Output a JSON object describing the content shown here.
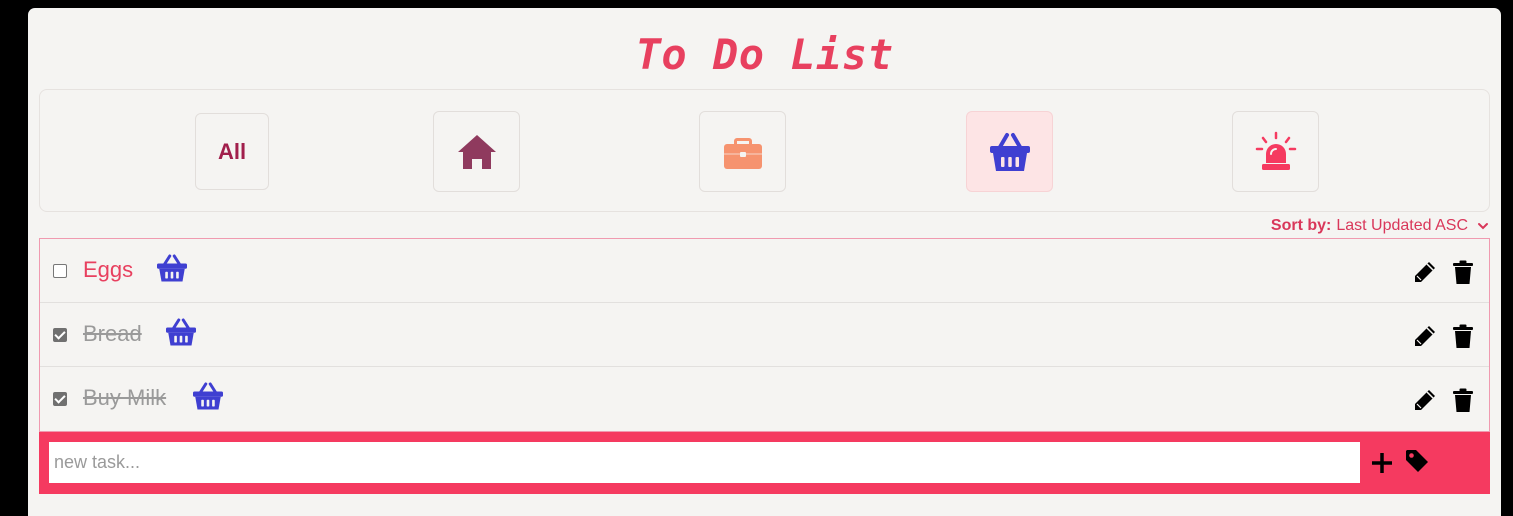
{
  "app": {
    "title": "To Do List"
  },
  "filters": [
    {
      "label": "All",
      "icon": "",
      "active": false
    },
    {
      "label": "",
      "icon": "home-icon",
      "active": false
    },
    {
      "label": "",
      "icon": "briefcase-icon",
      "active": false
    },
    {
      "label": "",
      "icon": "basket-icon",
      "active": true
    },
    {
      "label": "",
      "icon": "alarm-siren-icon",
      "active": false
    }
  ],
  "sort": {
    "label": "Sort by:",
    "value": "Last Updated ASC"
  },
  "tasks": [
    {
      "text": "Eggs",
      "done": false,
      "category_icon": "basket-icon"
    },
    {
      "text": "Bread",
      "done": true,
      "category_icon": "basket-icon"
    },
    {
      "text": "Buy Milk",
      "done": true,
      "category_icon": "basket-icon"
    }
  ],
  "new_task": {
    "placeholder": "new task..."
  },
  "colors": {
    "title": "#e8405f",
    "accent": "#f53a60",
    "home": "#8f3a5e",
    "briefcase": "#f6936f",
    "basket": "#3f3fd1",
    "siren": "#f53a60",
    "active_filter_bg": "#fde4e5"
  }
}
